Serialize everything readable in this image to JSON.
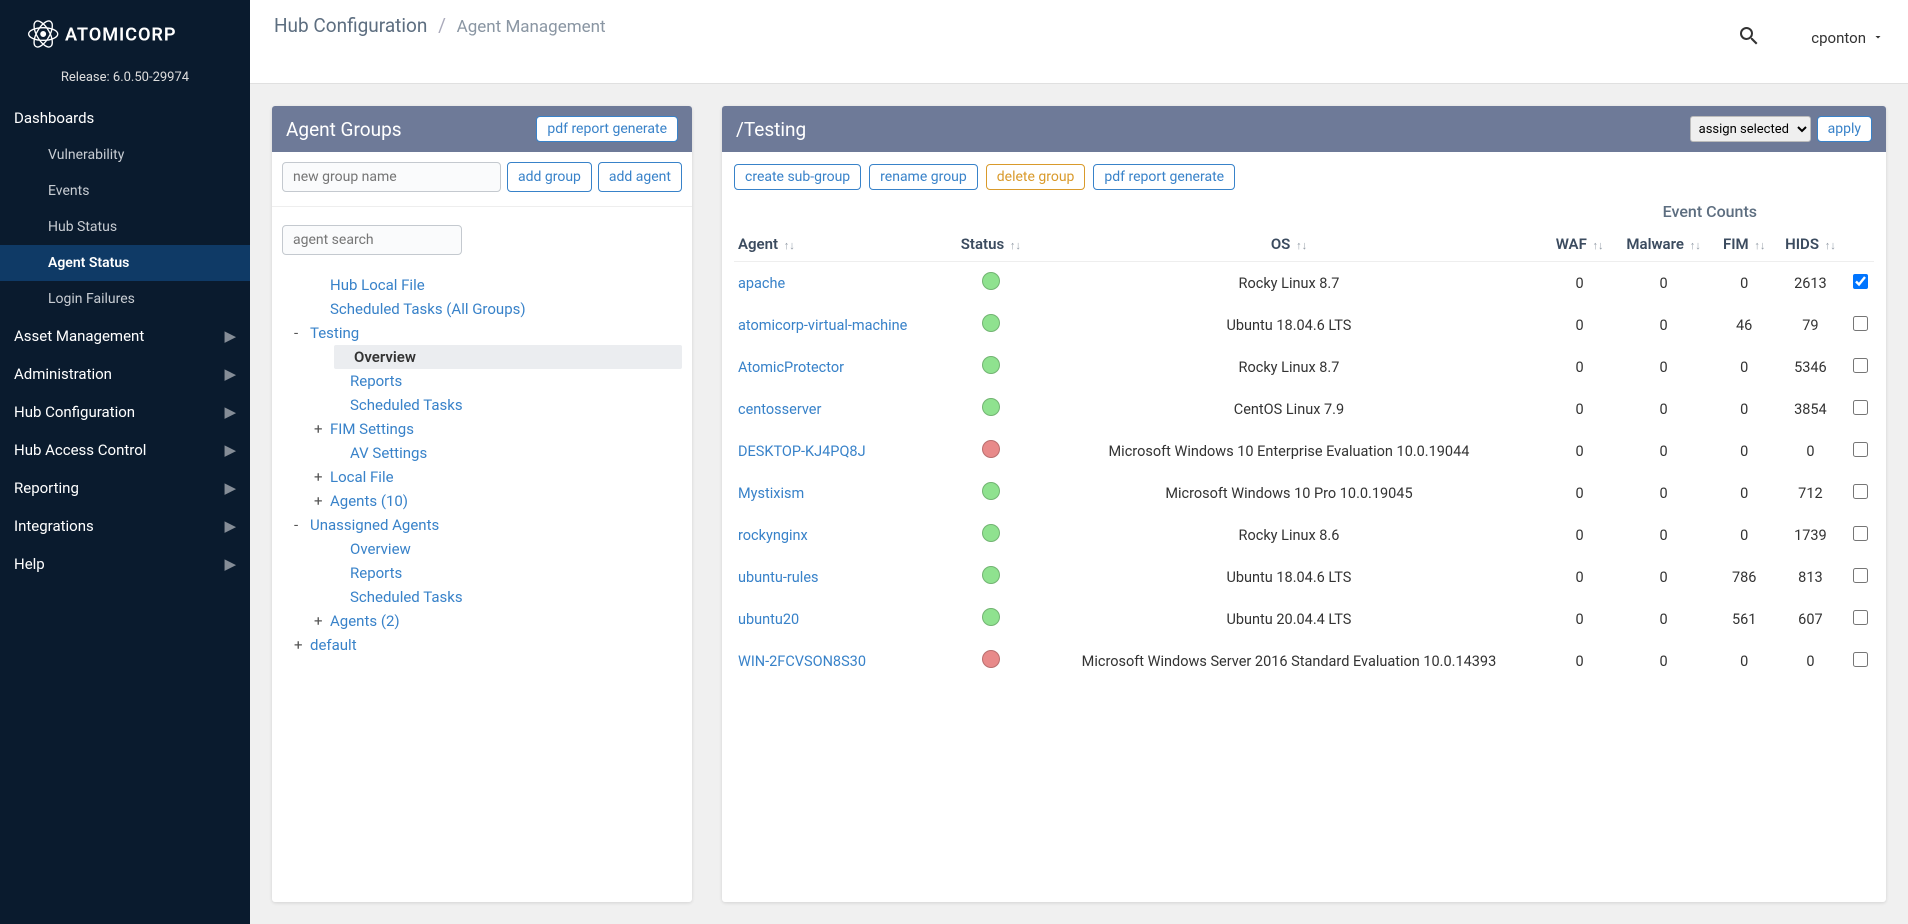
{
  "brand": "ATOMICORP",
  "release": "Release: 6.0.50-29974",
  "sidebar": {
    "sections": [
      {
        "label": "Dashboards",
        "expandable": false,
        "children": [
          "Vulnerability",
          "Events",
          "Hub Status",
          "Agent Status",
          "Login Failures"
        ],
        "active_child": 3
      },
      {
        "label": "Asset Management",
        "expandable": true
      },
      {
        "label": "Administration",
        "expandable": true
      },
      {
        "label": "Hub Configuration",
        "expandable": true
      },
      {
        "label": "Hub Access Control",
        "expandable": true
      },
      {
        "label": "Reporting",
        "expandable": true
      },
      {
        "label": "Integrations",
        "expandable": true
      },
      {
        "label": "Help",
        "expandable": true
      }
    ]
  },
  "breadcrumb": {
    "root": "Hub Configuration",
    "current": "Agent Management",
    "sep": "/"
  },
  "user": "cponton",
  "groups_panel": {
    "title": "Agent Groups",
    "pdf_btn": "pdf report generate",
    "new_group_placeholder": "new group name",
    "add_group_btn": "add group",
    "add_agent_btn": "add agent",
    "search_placeholder": "agent search",
    "tree": [
      {
        "lvl": 1,
        "label": "Hub Local File"
      },
      {
        "lvl": 1,
        "label": "Scheduled Tasks (All Groups)"
      },
      {
        "lvl": 0,
        "label": "Testing",
        "exp": "-"
      },
      {
        "lvl": 2,
        "label": "Overview",
        "sel": true
      },
      {
        "lvl": 2,
        "label": "Reports"
      },
      {
        "lvl": 2,
        "label": "Scheduled Tasks"
      },
      {
        "lvl": 1,
        "label": "FIM Settings",
        "exp": "+"
      },
      {
        "lvl": 2,
        "label": "AV Settings"
      },
      {
        "lvl": 1,
        "label": "Local File",
        "exp": "+"
      },
      {
        "lvl": 1,
        "label": "Agents (10)",
        "exp": "+"
      },
      {
        "lvl": 0,
        "label": "Unassigned Agents",
        "exp": "-"
      },
      {
        "lvl": 2,
        "label": "Overview"
      },
      {
        "lvl": 2,
        "label": "Reports"
      },
      {
        "lvl": 2,
        "label": "Scheduled Tasks"
      },
      {
        "lvl": 1,
        "label": "Agents (2)",
        "exp": "+"
      },
      {
        "lvl": 0,
        "label": "default",
        "exp": "+"
      }
    ]
  },
  "detail_panel": {
    "title": "/Testing",
    "assign_selected": "assign selected",
    "apply": "apply",
    "toolbar": [
      "create sub-group",
      "rename group",
      "delete group",
      "pdf report generate"
    ],
    "super_header": "Event Counts",
    "cols": [
      "Agent",
      "Status",
      "OS",
      "WAF",
      "Malware",
      "FIM",
      "HIDS",
      ""
    ],
    "rows": [
      {
        "agent": "apache",
        "status": "green",
        "os": "Rocky Linux 8.7",
        "waf": 0,
        "mal": 0,
        "fim": 0,
        "hids": 2613,
        "chk": true
      },
      {
        "agent": "atomicorp-virtual-machine",
        "status": "green",
        "os": "Ubuntu 18.04.6 LTS",
        "waf": 0,
        "mal": 0,
        "fim": 46,
        "hids": 79,
        "chk": false
      },
      {
        "agent": "AtomicProtector",
        "status": "green",
        "os": "Rocky Linux 8.7",
        "waf": 0,
        "mal": 0,
        "fim": 0,
        "hids": 5346,
        "chk": false
      },
      {
        "agent": "centosserver",
        "status": "green",
        "os": "CentOS Linux 7.9",
        "waf": 0,
        "mal": 0,
        "fim": 0,
        "hids": 3854,
        "chk": false
      },
      {
        "agent": "DESKTOP-KJ4PQ8J",
        "status": "red",
        "os": "Microsoft Windows 10 Enterprise Evaluation 10.0.19044",
        "waf": 0,
        "mal": 0,
        "fim": 0,
        "hids": 0,
        "chk": false
      },
      {
        "agent": "Mystixism",
        "status": "green",
        "os": "Microsoft Windows 10 Pro 10.0.19045",
        "waf": 0,
        "mal": 0,
        "fim": 0,
        "hids": 712,
        "chk": false
      },
      {
        "agent": "rockynginx",
        "status": "green",
        "os": "Rocky Linux 8.6",
        "waf": 0,
        "mal": 0,
        "fim": 0,
        "hids": 1739,
        "chk": false
      },
      {
        "agent": "ubuntu-rules",
        "status": "green",
        "os": "Ubuntu 18.04.6 LTS",
        "waf": 0,
        "mal": 0,
        "fim": 786,
        "hids": 813,
        "chk": false
      },
      {
        "agent": "ubuntu20",
        "status": "green",
        "os": "Ubuntu 20.04.4 LTS",
        "waf": 0,
        "mal": 0,
        "fim": 561,
        "hids": 607,
        "chk": false
      },
      {
        "agent": "WIN-2FCVSON8S30",
        "status": "red",
        "os": "Microsoft Windows Server 2016 Standard Evaluation 10.0.14393",
        "waf": 0,
        "mal": 0,
        "fim": 0,
        "hids": 0,
        "chk": false
      }
    ]
  }
}
